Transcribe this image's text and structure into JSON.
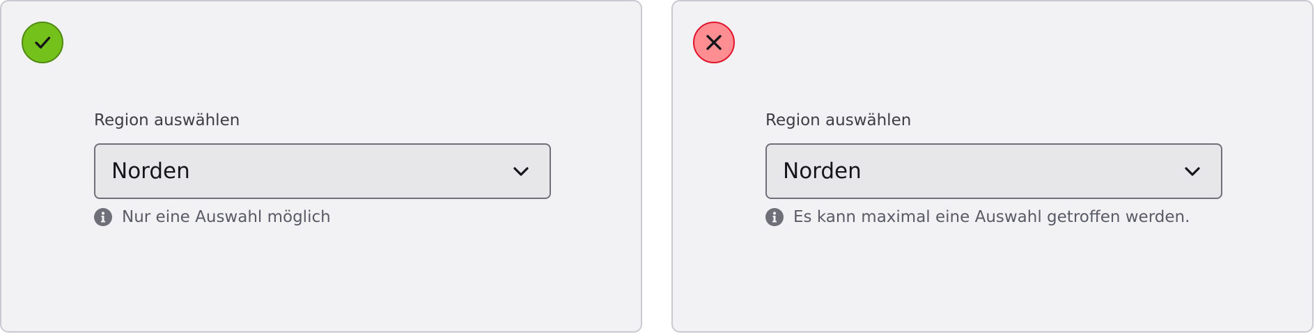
{
  "colors": {
    "panel_bg": "#f2f2f4",
    "panel_border": "#c9c9cf",
    "good": "#74c11c",
    "bad": "#ff8e93",
    "bad_border": "#e0142b"
  },
  "examples": {
    "good": {
      "status_icon": "check-icon",
      "label": "Region auswählen",
      "select_value": "Norden",
      "hint_icon": "info-icon",
      "hint": "Nur eine Auswahl möglich"
    },
    "bad": {
      "status_icon": "close-icon",
      "label": "Region auswählen",
      "select_value": "Norden",
      "hint_icon": "info-icon",
      "hint": "Es kann maximal eine Auswahl getroffen werden."
    }
  }
}
